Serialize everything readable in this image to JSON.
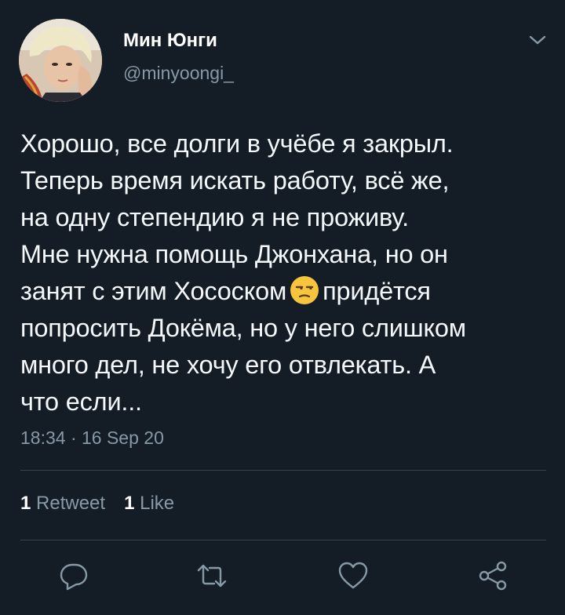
{
  "user": {
    "display_name": "Мин Юнги",
    "handle": "@minyoongi_"
  },
  "tweet": {
    "lines": [
      "Хорошо, все долги в учёбе я закрыл.",
      "Теперь время искать работу, всё же,",
      "на одну степендию я не проживу.",
      "Мне нужна помощь Джонхана, но он",
      "занят с этим Хососком",
      "придётся",
      "попросить Докёма, но у него слишком",
      "много дел, не хочу его отвлекать. А",
      "что если..."
    ],
    "emoji": "unamused-face-emoji",
    "timestamp": "18:34 · 16 Sep 20"
  },
  "stats": {
    "retweets_count": "1",
    "retweets_label": "Retweet",
    "likes_count": "1",
    "likes_label": "Like"
  },
  "icons": {
    "caret": "chevron-down-icon",
    "reply": "reply-icon",
    "retweet": "retweet-icon",
    "like": "heart-icon",
    "share": "share-icon"
  },
  "colors": {
    "background": "#141d26",
    "text": "#f5f8fa",
    "secondary": "#8899a6",
    "divider": "#38444d"
  }
}
